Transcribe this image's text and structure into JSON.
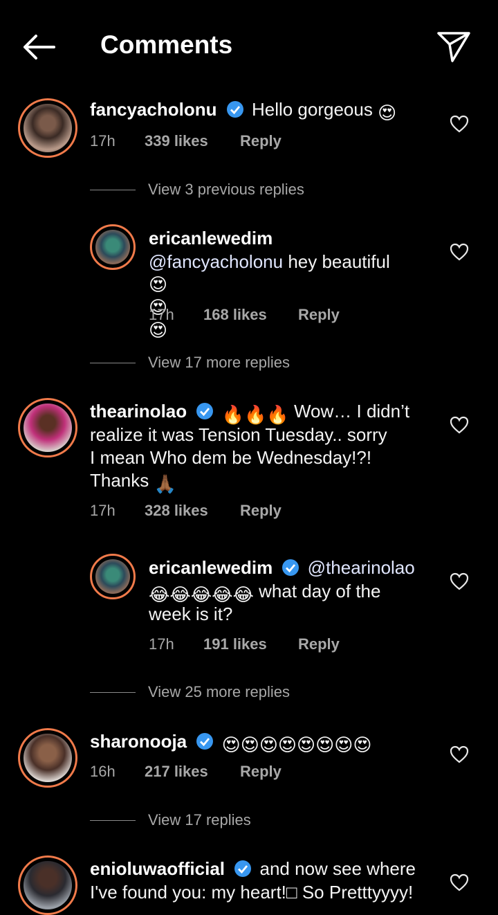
{
  "header": {
    "title": "Comments",
    "back_icon": "arrow-left-icon",
    "send_icon": "paper-plane-icon"
  },
  "colors": {
    "background": "#000000",
    "verified": "#3897f0",
    "avatar_ring": "#f07a4a",
    "muted": "#a8a8a8"
  },
  "comments": [
    {
      "user": "fancyacholonu",
      "text": "Hello gorgeous",
      "emojis": "😍",
      "time": "17h",
      "likes": "339 likes",
      "reply": "Reply"
    },
    {
      "view_more": "View 3 previous replies"
    },
    {
      "user": "ericanlewedim",
      "mention": "@fancyacholonu",
      "text": "hey beautiful",
      "emojis": "😍😍😍",
      "time": "17h",
      "likes": "168 likes",
      "reply": "Reply"
    },
    {
      "view_more": "View 17 more replies"
    },
    {
      "user": "thearinolao",
      "emojis_pre": "🔥🔥🔥",
      "text_line1": "Wow… I didn’t",
      "text_line2": "realize it was Tension Tuesday.. sorry",
      "text_line3": "I mean Who dem be Wednesday!?!",
      "text_line4": "Thanks",
      "emojis_post": "🙏🏾",
      "time": "17h",
      "likes": "328 likes",
      "reply": "Reply"
    },
    {
      "user": "ericanlewedim",
      "mention": "@thearinolao",
      "emojis": "😂😂😂😂😂",
      "text_line2": "what day of the",
      "text_line3": "week is it?",
      "time": "17h",
      "likes": "191 likes",
      "reply": "Reply"
    },
    {
      "view_more": "View 25 more replies"
    },
    {
      "user": "sharonooja",
      "emojis": "😍😍😍😍😍😍😍😍",
      "time": "16h",
      "likes": "217 likes",
      "reply": "Reply"
    },
    {
      "view_more": "View 17 replies"
    },
    {
      "user": "enioluwaofficial",
      "text_line1": "and now see where",
      "text_line2": "I've found you: my heart!□ So Pretttyyyy!"
    }
  ]
}
